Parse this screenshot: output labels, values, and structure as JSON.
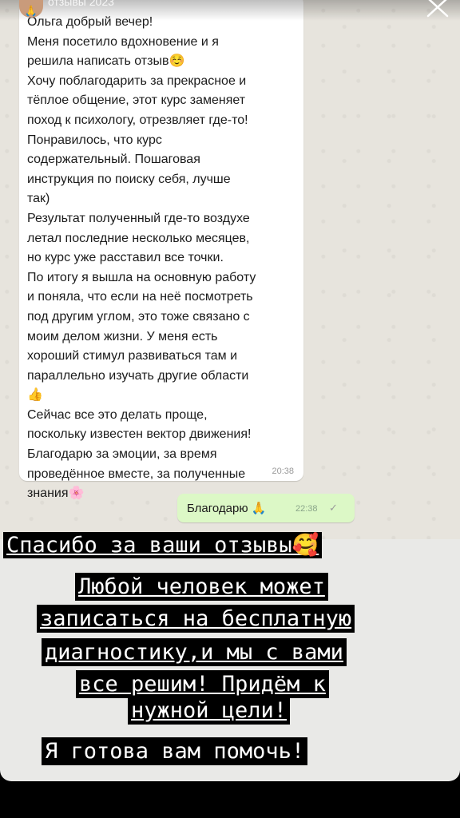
{
  "header": {
    "story_label": "отзывы 2023",
    "avatar_emoji": "🙏"
  },
  "incoming_message": {
    "lines": [
      "Ольга добрый вечер!",
      "Меня посетило вдохновение и я",
      "решила написать отзыв☺️",
      "Хочу поблагодарить за прекрасное и",
      "тёплое общение, этот курс заменяет",
      "поход к психологу, отрезвляет где-то!",
      "Понравилось, что курс",
      "содержательный. Пошаговая",
      "инструкция по поиску себя, лучше",
      "так)",
      "Результат полученный где-то воздухе",
      "летал последние несколько месяцев,",
      "но курс уже расставил все точки.",
      "По итогу я вышла на основную работу",
      "и поняла, что если на неё посмотреть",
      "под другим углом, это тоже связано с",
      "моим делом жизни.  У меня есть",
      "хороший стимул развиваться там и",
      "параллельно изучать другие области",
      "👍",
      "Сейчас все это делать проще,",
      "поскольку известен вектор движения!",
      "Благодарю за эмоции, за время",
      "проведённое вместе, за полученные",
      "знания🌸"
    ],
    "time": "20:38"
  },
  "outgoing_message": {
    "text": "Благодарю 🙏",
    "time": "22:38",
    "status": "✓"
  },
  "overlay": {
    "thanks": "Спасибо за ваши отзывы🥰",
    "line1": "Любой человек может",
    "line2": "записаться на бесплатную",
    "line3": "диагностику,и мы с вами",
    "line4": "все решим! Придём к",
    "line5": "нужной цели!",
    "line6": "Я готова вам помочь!"
  },
  "colors": {
    "incoming_bubble": "#ffffff",
    "outgoing_bubble": "#dcf8c6",
    "highlight": "#000000"
  }
}
